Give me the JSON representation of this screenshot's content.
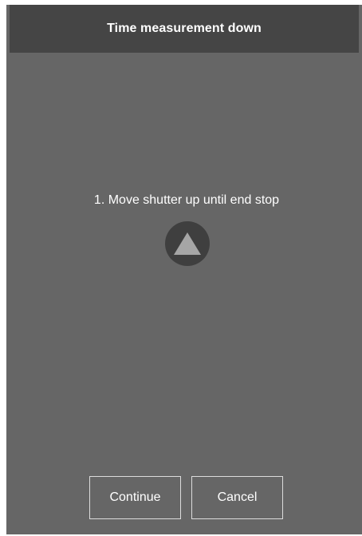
{
  "dialog": {
    "title": "Time measurement down",
    "instruction": "1. Move shutter up until end stop",
    "up_button_icon": "triangle-up-icon",
    "continue_label": "Continue",
    "cancel_label": "Cancel"
  },
  "colors": {
    "background": "#666666",
    "titlebar": "#454545",
    "text": "#ffffff",
    "up_button_bg": "#3f3f3f",
    "up_arrow": "#a6a6a6",
    "button_border": "#dcdcdc"
  }
}
